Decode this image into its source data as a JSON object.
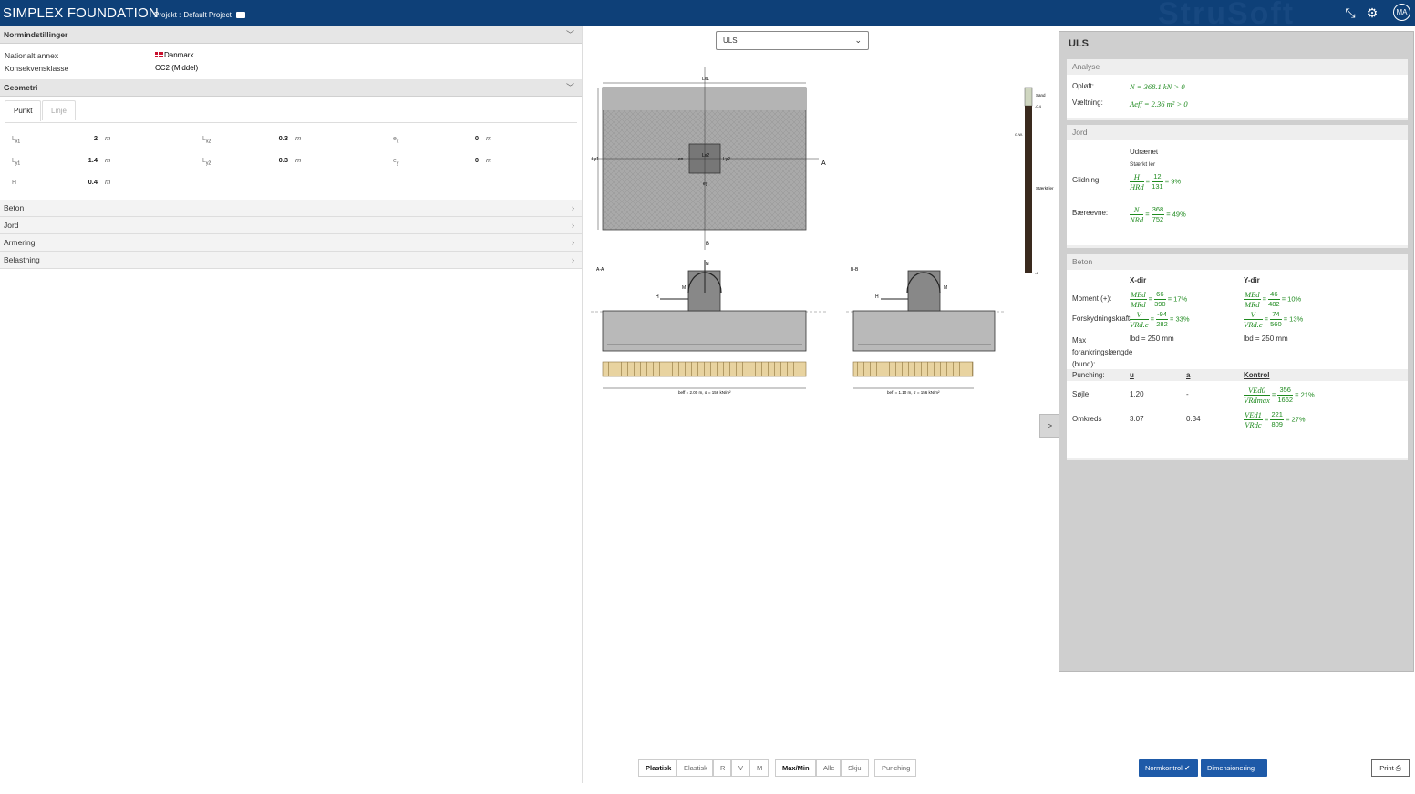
{
  "app": {
    "logo_a": "SIMPLEX",
    "logo_b": "FOUNDATION",
    "project_label": "Projekt :",
    "project_name": "Default Project",
    "watermark": "StruSoft",
    "avatar": "MA"
  },
  "left": {
    "sec_norm": "Normindstillinger",
    "annex_label": "Nationalt annex",
    "annex_value": "Danmark",
    "class_label": "Konsekvensklasse",
    "class_value": "CC2 (Middel)",
    "sec_geo": "Geometri",
    "tab_punkt": "Punkt",
    "tab_linje": "Linje",
    "geo": [
      {
        "sym": "L",
        "sub": "x1",
        "val": "2",
        "unit": "m"
      },
      {
        "sym": "L",
        "sub": "x2",
        "val": "0.3",
        "unit": "m"
      },
      {
        "sym": "e",
        "sub": "x",
        "val": "0",
        "unit": "m"
      },
      {
        "sym": "L",
        "sub": "y1",
        "val": "1.4",
        "unit": "m"
      },
      {
        "sym": "L",
        "sub": "y2",
        "val": "0.3",
        "unit": "m"
      },
      {
        "sym": "e",
        "sub": "y",
        "val": "0",
        "unit": "m"
      },
      {
        "sym": "H",
        "sub": "",
        "val": "0.4",
        "unit": "m"
      }
    ],
    "sections": [
      "Beton",
      "Jord",
      "Armering",
      "Belastning"
    ]
  },
  "center": {
    "combo": "ULS",
    "labels": {
      "aa": "A-A",
      "bb": "B-B",
      "N": "N",
      "H": "H",
      "M": "M",
      "b_aa": "beff = 2.00 m, σ = 156 kN/m²",
      "b_bb": "beff = 1.10 m, σ = 156 kN/m²",
      "soil1": "Sand",
      "soil2": "Stærkt ler",
      "gw": "G.W.",
      "d1": "-0.4",
      "d2": "-4",
      "lx1": "Lx1",
      "ly1": "Ly1",
      "lx2": "Lx2",
      "ly2": "Ly2",
      "ex": "ex",
      "ey": "ey",
      "sA": "A",
      "sB": "B"
    }
  },
  "toggle": ">",
  "uls": {
    "title": "ULS",
    "analyse": {
      "title": "Analyse",
      "oploft_label": "Opløft:",
      "oploft_expr": "N = 368.1 kN > 0",
      "vaeltning_label": "Væltning:",
      "vaeltning_expr": "Aeff = 2.36 m² > 0"
    },
    "jord": {
      "title": "Jord",
      "type": "Udrænet",
      "subtype": "Stærkt ler",
      "glid_label": "Glidning:",
      "glid_lhs_n": "H",
      "glid_lhs_d": "HRd",
      "glid_n": "12",
      "glid_d": "131",
      "glid_pct": "= 9%",
      "baer_label": "Bæreevne:",
      "baer_lhs_n": "N",
      "baer_lhs_d": "NRd",
      "baer_n": "368",
      "baer_d": "752",
      "baer_pct": "= 49%"
    },
    "beton": {
      "title": "Beton",
      "xdir": "X-dir",
      "ydir": "Y-dir",
      "moment_label": "Moment (+):",
      "mx_n": "66",
      "mx_d": "390",
      "mx_pct": "= 17%",
      "my_n": "46",
      "my_d": "482",
      "my_pct": "= 10%",
      "m_lhs_n": "MEd",
      "m_lhs_d": "MRd",
      "shear_label": "Forskydningskraft:",
      "vx_n": "-94",
      "vx_d": "282",
      "vx_pct": "= 33%",
      "vy_n": "74",
      "vy_d": "560",
      "vy_pct": "= 13%",
      "v_lhs_n": "V",
      "v_lhs_d": "VRd.c",
      "max_l1": "Max",
      "max_l2": "forankringslængde",
      "max_l3": "(bund):",
      "lbd_x": "lbd = 250 mm",
      "lbd_y": "lbd = 250 mm",
      "punch_label": "Punching:",
      "col_u": "u",
      "col_a": "a",
      "col_k": "Kontrol",
      "sojle_label": "Søjle",
      "sojle_u": "1.20",
      "sojle_a": "-",
      "s_lhs_n": "VEd0",
      "s_lhs_d": "VRdmax",
      "s_n": "356",
      "s_d": "1662",
      "s_pct": "= 21%",
      "omk_label": "Omkreds",
      "omk_u": "3.07",
      "omk_a": "0.34",
      "o_lhs_n": "VEd1",
      "o_lhs_d": "VRdc",
      "o_n": "221",
      "o_d": "809",
      "o_pct": "= 27%"
    }
  },
  "bottom": {
    "plastisk": "Plastisk",
    "elastisk": "Elastisk",
    "r": "R",
    "v": "V",
    "m": "M",
    "maxmin": "Max/Min",
    "alle": "Alle",
    "skjul": "Skjul",
    "punching": "Punching",
    "normkontrol": "Normkontrol",
    "dimensionering": "Dimensionering",
    "print": "Print"
  }
}
